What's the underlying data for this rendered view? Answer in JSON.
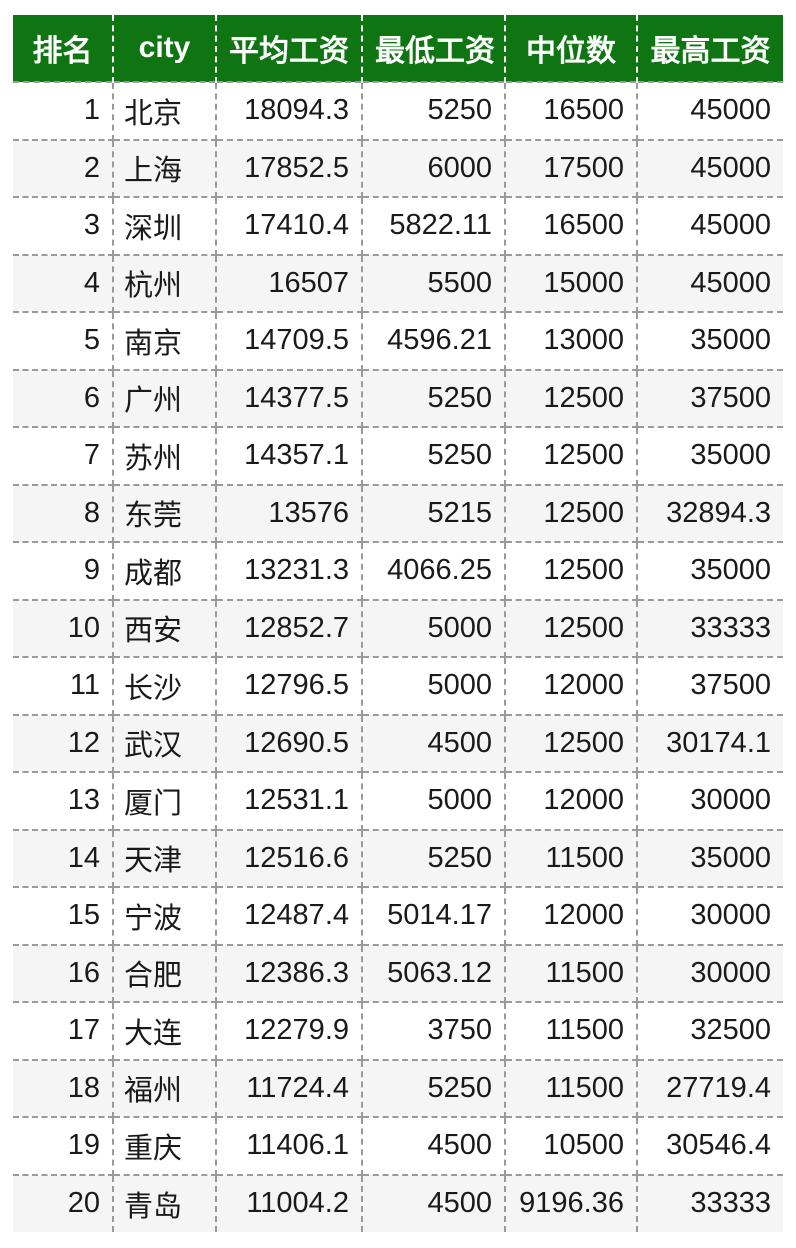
{
  "table": {
    "columns": [
      {
        "key": "rank",
        "label": "排名"
      },
      {
        "key": "city",
        "label": "city"
      },
      {
        "key": "avg",
        "label": "平均工资"
      },
      {
        "key": "min",
        "label": "最低工资"
      },
      {
        "key": "median",
        "label": "中位数"
      },
      {
        "key": "max",
        "label": "最高工资"
      }
    ],
    "header_bg": "#0f7512",
    "header_fg": "#ffffff",
    "row_bg_odd": "#ffffff",
    "row_bg_even": "#f5f5f5",
    "border_color": "#9a9a9a",
    "rows": [
      {
        "rank": "1",
        "city": "北京",
        "avg": "18094.3",
        "min": "5250",
        "median": "16500",
        "max": "45000"
      },
      {
        "rank": "2",
        "city": "上海",
        "avg": "17852.5",
        "min": "6000",
        "median": "17500",
        "max": "45000"
      },
      {
        "rank": "3",
        "city": "深圳",
        "avg": "17410.4",
        "min": "5822.11",
        "median": "16500",
        "max": "45000"
      },
      {
        "rank": "4",
        "city": "杭州",
        "avg": "16507",
        "min": "5500",
        "median": "15000",
        "max": "45000"
      },
      {
        "rank": "5",
        "city": "南京",
        "avg": "14709.5",
        "min": "4596.21",
        "median": "13000",
        "max": "35000"
      },
      {
        "rank": "6",
        "city": "广州",
        "avg": "14377.5",
        "min": "5250",
        "median": "12500",
        "max": "37500"
      },
      {
        "rank": "7",
        "city": "苏州",
        "avg": "14357.1",
        "min": "5250",
        "median": "12500",
        "max": "35000"
      },
      {
        "rank": "8",
        "city": "东莞",
        "avg": "13576",
        "min": "5215",
        "median": "12500",
        "max": "32894.3"
      },
      {
        "rank": "9",
        "city": "成都",
        "avg": "13231.3",
        "min": "4066.25",
        "median": "12500",
        "max": "35000"
      },
      {
        "rank": "10",
        "city": "西安",
        "avg": "12852.7",
        "min": "5000",
        "median": "12500",
        "max": "33333"
      },
      {
        "rank": "11",
        "city": "长沙",
        "avg": "12796.5",
        "min": "5000",
        "median": "12000",
        "max": "37500"
      },
      {
        "rank": "12",
        "city": "武汉",
        "avg": "12690.5",
        "min": "4500",
        "median": "12500",
        "max": "30174.1"
      },
      {
        "rank": "13",
        "city": "厦门",
        "avg": "12531.1",
        "min": "5000",
        "median": "12000",
        "max": "30000"
      },
      {
        "rank": "14",
        "city": "天津",
        "avg": "12516.6",
        "min": "5250",
        "median": "11500",
        "max": "35000"
      },
      {
        "rank": "15",
        "city": "宁波",
        "avg": "12487.4",
        "min": "5014.17",
        "median": "12000",
        "max": "30000"
      },
      {
        "rank": "16",
        "city": "合肥",
        "avg": "12386.3",
        "min": "5063.12",
        "median": "11500",
        "max": "30000"
      },
      {
        "rank": "17",
        "city": "大连",
        "avg": "12279.9",
        "min": "3750",
        "median": "11500",
        "max": "32500"
      },
      {
        "rank": "18",
        "city": "福州",
        "avg": "11724.4",
        "min": "5250",
        "median": "11500",
        "max": "27719.4"
      },
      {
        "rank": "19",
        "city": "重庆",
        "avg": "11406.1",
        "min": "4500",
        "median": "10500",
        "max": "30546.4"
      },
      {
        "rank": "20",
        "city": "青岛",
        "avg": "11004.2",
        "min": "4500",
        "median": "9196.36",
        "max": "33333"
      }
    ]
  }
}
